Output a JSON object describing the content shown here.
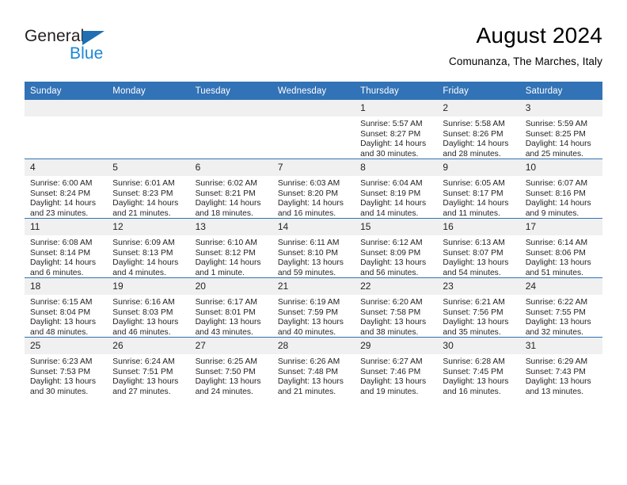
{
  "brand": {
    "name_dark": "General",
    "name_light": "Blue",
    "triangle_color": "#1f6fb2",
    "light_color": "#1b88d4"
  },
  "header": {
    "title": "August 2024",
    "subtitle": "Comunanza, The Marches, Italy"
  },
  "theme": {
    "header_blue": "#3272b6",
    "daynum_bg": "#f0f0f0",
    "text": "#231f20"
  },
  "weekday_headers": [
    "Sunday",
    "Monday",
    "Tuesday",
    "Wednesday",
    "Thursday",
    "Friday",
    "Saturday"
  ],
  "weeks": [
    [
      {
        "day": "",
        "sunrise": "",
        "sunset": "",
        "daylight_1": "",
        "daylight_2": ""
      },
      {
        "day": "",
        "sunrise": "",
        "sunset": "",
        "daylight_1": "",
        "daylight_2": ""
      },
      {
        "day": "",
        "sunrise": "",
        "sunset": "",
        "daylight_1": "",
        "daylight_2": ""
      },
      {
        "day": "",
        "sunrise": "",
        "sunset": "",
        "daylight_1": "",
        "daylight_2": ""
      },
      {
        "day": "1",
        "sunrise": "Sunrise: 5:57 AM",
        "sunset": "Sunset: 8:27 PM",
        "daylight_1": "Daylight: 14 hours",
        "daylight_2": "and 30 minutes."
      },
      {
        "day": "2",
        "sunrise": "Sunrise: 5:58 AM",
        "sunset": "Sunset: 8:26 PM",
        "daylight_1": "Daylight: 14 hours",
        "daylight_2": "and 28 minutes."
      },
      {
        "day": "3",
        "sunrise": "Sunrise: 5:59 AM",
        "sunset": "Sunset: 8:25 PM",
        "daylight_1": "Daylight: 14 hours",
        "daylight_2": "and 25 minutes."
      }
    ],
    [
      {
        "day": "4",
        "sunrise": "Sunrise: 6:00 AM",
        "sunset": "Sunset: 8:24 PM",
        "daylight_1": "Daylight: 14 hours",
        "daylight_2": "and 23 minutes."
      },
      {
        "day": "5",
        "sunrise": "Sunrise: 6:01 AM",
        "sunset": "Sunset: 8:23 PM",
        "daylight_1": "Daylight: 14 hours",
        "daylight_2": "and 21 minutes."
      },
      {
        "day": "6",
        "sunrise": "Sunrise: 6:02 AM",
        "sunset": "Sunset: 8:21 PM",
        "daylight_1": "Daylight: 14 hours",
        "daylight_2": "and 18 minutes."
      },
      {
        "day": "7",
        "sunrise": "Sunrise: 6:03 AM",
        "sunset": "Sunset: 8:20 PM",
        "daylight_1": "Daylight: 14 hours",
        "daylight_2": "and 16 minutes."
      },
      {
        "day": "8",
        "sunrise": "Sunrise: 6:04 AM",
        "sunset": "Sunset: 8:19 PM",
        "daylight_1": "Daylight: 14 hours",
        "daylight_2": "and 14 minutes."
      },
      {
        "day": "9",
        "sunrise": "Sunrise: 6:05 AM",
        "sunset": "Sunset: 8:17 PM",
        "daylight_1": "Daylight: 14 hours",
        "daylight_2": "and 11 minutes."
      },
      {
        "day": "10",
        "sunrise": "Sunrise: 6:07 AM",
        "sunset": "Sunset: 8:16 PM",
        "daylight_1": "Daylight: 14 hours",
        "daylight_2": "and 9 minutes."
      }
    ],
    [
      {
        "day": "11",
        "sunrise": "Sunrise: 6:08 AM",
        "sunset": "Sunset: 8:14 PM",
        "daylight_1": "Daylight: 14 hours",
        "daylight_2": "and 6 minutes."
      },
      {
        "day": "12",
        "sunrise": "Sunrise: 6:09 AM",
        "sunset": "Sunset: 8:13 PM",
        "daylight_1": "Daylight: 14 hours",
        "daylight_2": "and 4 minutes."
      },
      {
        "day": "13",
        "sunrise": "Sunrise: 6:10 AM",
        "sunset": "Sunset: 8:12 PM",
        "daylight_1": "Daylight: 14 hours",
        "daylight_2": "and 1 minute."
      },
      {
        "day": "14",
        "sunrise": "Sunrise: 6:11 AM",
        "sunset": "Sunset: 8:10 PM",
        "daylight_1": "Daylight: 13 hours",
        "daylight_2": "and 59 minutes."
      },
      {
        "day": "15",
        "sunrise": "Sunrise: 6:12 AM",
        "sunset": "Sunset: 8:09 PM",
        "daylight_1": "Daylight: 13 hours",
        "daylight_2": "and 56 minutes."
      },
      {
        "day": "16",
        "sunrise": "Sunrise: 6:13 AM",
        "sunset": "Sunset: 8:07 PM",
        "daylight_1": "Daylight: 13 hours",
        "daylight_2": "and 54 minutes."
      },
      {
        "day": "17",
        "sunrise": "Sunrise: 6:14 AM",
        "sunset": "Sunset: 8:06 PM",
        "daylight_1": "Daylight: 13 hours",
        "daylight_2": "and 51 minutes."
      }
    ],
    [
      {
        "day": "18",
        "sunrise": "Sunrise: 6:15 AM",
        "sunset": "Sunset: 8:04 PM",
        "daylight_1": "Daylight: 13 hours",
        "daylight_2": "and 48 minutes."
      },
      {
        "day": "19",
        "sunrise": "Sunrise: 6:16 AM",
        "sunset": "Sunset: 8:03 PM",
        "daylight_1": "Daylight: 13 hours",
        "daylight_2": "and 46 minutes."
      },
      {
        "day": "20",
        "sunrise": "Sunrise: 6:17 AM",
        "sunset": "Sunset: 8:01 PM",
        "daylight_1": "Daylight: 13 hours",
        "daylight_2": "and 43 minutes."
      },
      {
        "day": "21",
        "sunrise": "Sunrise: 6:19 AM",
        "sunset": "Sunset: 7:59 PM",
        "daylight_1": "Daylight: 13 hours",
        "daylight_2": "and 40 minutes."
      },
      {
        "day": "22",
        "sunrise": "Sunrise: 6:20 AM",
        "sunset": "Sunset: 7:58 PM",
        "daylight_1": "Daylight: 13 hours",
        "daylight_2": "and 38 minutes."
      },
      {
        "day": "23",
        "sunrise": "Sunrise: 6:21 AM",
        "sunset": "Sunset: 7:56 PM",
        "daylight_1": "Daylight: 13 hours",
        "daylight_2": "and 35 minutes."
      },
      {
        "day": "24",
        "sunrise": "Sunrise: 6:22 AM",
        "sunset": "Sunset: 7:55 PM",
        "daylight_1": "Daylight: 13 hours",
        "daylight_2": "and 32 minutes."
      }
    ],
    [
      {
        "day": "25",
        "sunrise": "Sunrise: 6:23 AM",
        "sunset": "Sunset: 7:53 PM",
        "daylight_1": "Daylight: 13 hours",
        "daylight_2": "and 30 minutes."
      },
      {
        "day": "26",
        "sunrise": "Sunrise: 6:24 AM",
        "sunset": "Sunset: 7:51 PM",
        "daylight_1": "Daylight: 13 hours",
        "daylight_2": "and 27 minutes."
      },
      {
        "day": "27",
        "sunrise": "Sunrise: 6:25 AM",
        "sunset": "Sunset: 7:50 PM",
        "daylight_1": "Daylight: 13 hours",
        "daylight_2": "and 24 minutes."
      },
      {
        "day": "28",
        "sunrise": "Sunrise: 6:26 AM",
        "sunset": "Sunset: 7:48 PM",
        "daylight_1": "Daylight: 13 hours",
        "daylight_2": "and 21 minutes."
      },
      {
        "day": "29",
        "sunrise": "Sunrise: 6:27 AM",
        "sunset": "Sunset: 7:46 PM",
        "daylight_1": "Daylight: 13 hours",
        "daylight_2": "and 19 minutes."
      },
      {
        "day": "30",
        "sunrise": "Sunrise: 6:28 AM",
        "sunset": "Sunset: 7:45 PM",
        "daylight_1": "Daylight: 13 hours",
        "daylight_2": "and 16 minutes."
      },
      {
        "day": "31",
        "sunrise": "Sunrise: 6:29 AM",
        "sunset": "Sunset: 7:43 PM",
        "daylight_1": "Daylight: 13 hours",
        "daylight_2": "and 13 minutes."
      }
    ]
  ]
}
